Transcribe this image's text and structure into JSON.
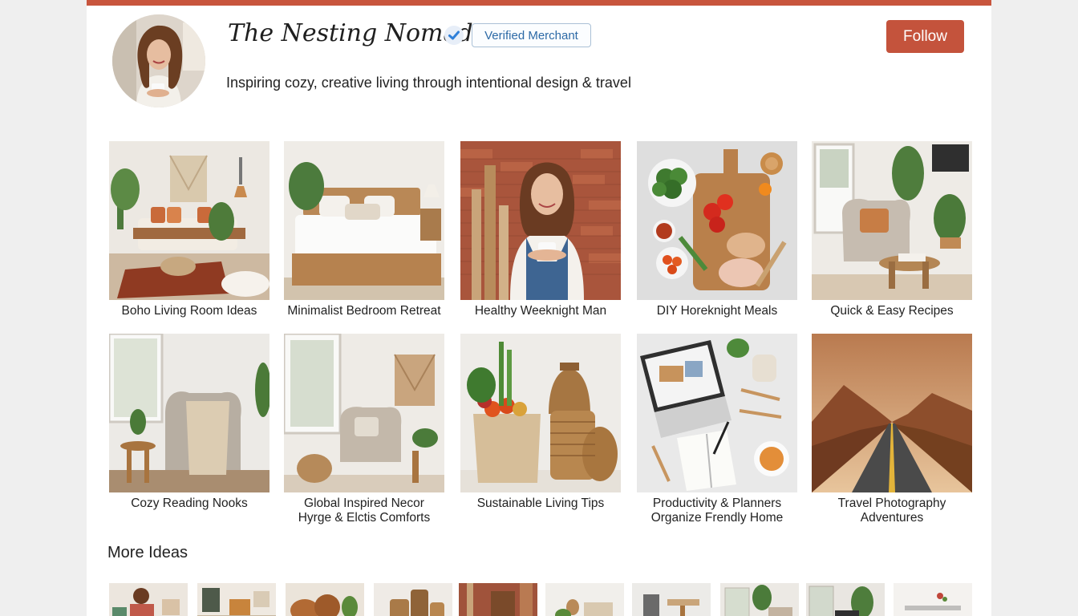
{
  "profile": {
    "name": "The Nesting Nomad",
    "verified_icon": "verified-check-icon",
    "badge": "Verified Merchant",
    "follow_label": "Follow",
    "tagline": "Inspiring cozy, creative living through intentional design & travel"
  },
  "colors": {
    "accent": "#c8553d",
    "badge_text": "#2d6aa6",
    "check": "#2f7fd8"
  },
  "boards": [
    {
      "lines": [
        "Boho Living Room Ideas"
      ]
    },
    {
      "lines": [
        "Minimalist Bedroom Retreat"
      ]
    },
    {
      "lines": [
        "Healthy Weeknight Man"
      ]
    },
    {
      "lines": [
        "DIY Horeknight Meals"
      ]
    },
    {
      "lines": [
        "Quick & Easy Recipes"
      ]
    },
    {
      "lines": [
        "Cozy Reading Nooks"
      ]
    },
    {
      "lines": [
        "Global Inspired Necor",
        "Hyrge & Elctis Comforts"
      ]
    },
    {
      "lines": [
        "Sustainable Living Tips"
      ]
    },
    {
      "lines": [
        "Productivity & Planners",
        "Organize Frendly Home"
      ]
    },
    {
      "lines": [
        "Travel Photography",
        "Adventures"
      ]
    }
  ],
  "more_ideas": {
    "title": "More Ideas",
    "thumb_count": 10
  }
}
